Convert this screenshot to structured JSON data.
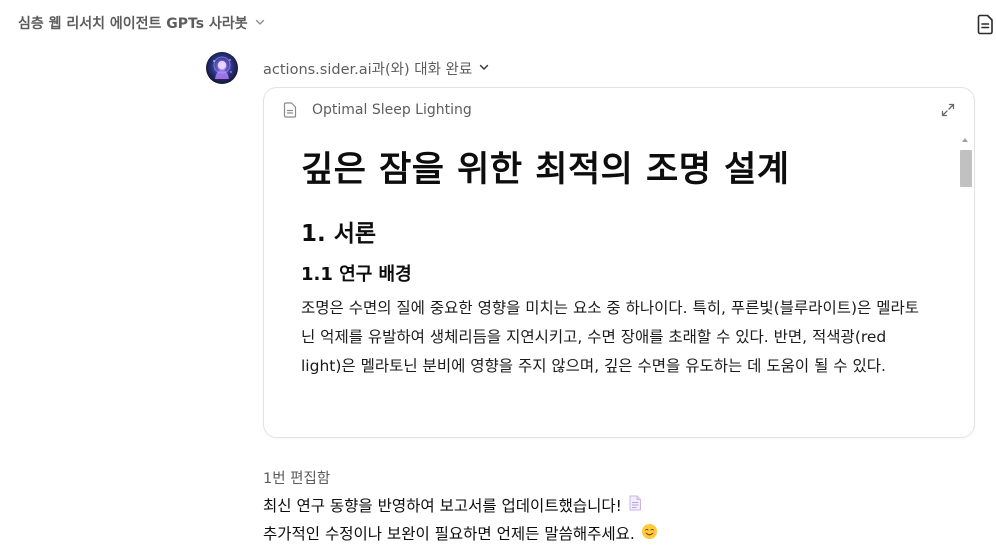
{
  "header": {
    "gpt_name": "심층 웹 리서치 에이전트 GPTs 사라봇"
  },
  "action": {
    "text": "actions.sider.ai과(와) 대화 완료"
  },
  "canvas": {
    "title": "Optimal Sleep Lighting",
    "heading1": "깊은 잠을 위한 최적의 조명 설계",
    "heading2": "1. 서론",
    "heading3": "1.1 연구 배경",
    "paragraph": "조명은 수면의 질에 중요한 영향을 미치는 요소 중 하나이다. 특히, 푸른빛(블루라이트)은 멜라토닌 억제를 유발하여 생체리듬을 지연시키고, 수면 장애를 초래할 수 있다. 반면, 적색광(red light)은 멜라토닌 분비에 영향을 주지 않으며, 깊은 수면을 유도하는 데 도움이 될 수 있다."
  },
  "message": {
    "edit_count": "1번 편집함",
    "line1": "최신 연구 동향을 반영하여 보고서를 업데이트했습니다!",
    "line2": "추가적인 수정이나 보완이 필요하면 언제든 말씀해주세요."
  },
  "icons": {
    "chevron": "chevron-down-icon",
    "doc": "document-icon",
    "file": "file-icon",
    "expand": "expand-icon",
    "page_emoji": "page-emoji-icon",
    "smile_emoji": "smiling-face-emoji-icon"
  },
  "colors": {
    "muted_text": "#5d5d5d",
    "card_border": "#e3e3e3",
    "scroll_thumb": "#c1c1c1"
  }
}
